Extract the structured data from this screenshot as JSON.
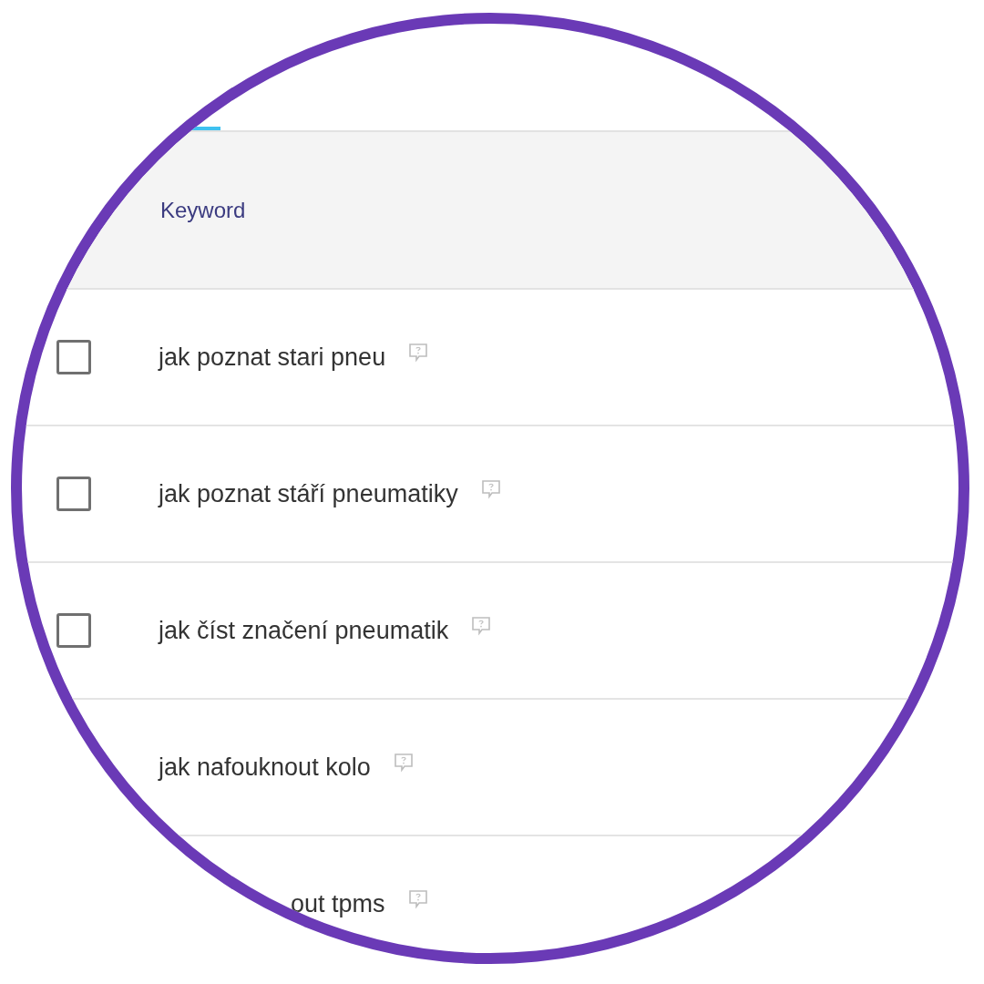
{
  "table": {
    "columns": [
      "Keyword"
    ],
    "rows": [
      {
        "keyword": "jak poznat stari pneu",
        "checked": false
      },
      {
        "keyword": "jak poznat stáří pneumatiky",
        "checked": false
      },
      {
        "keyword": "jak číst značení pneumatik",
        "checked": false
      },
      {
        "keyword": "jak nafouknout kolo"
      },
      {
        "keyword": "out tpms",
        "cut": true
      }
    ]
  }
}
